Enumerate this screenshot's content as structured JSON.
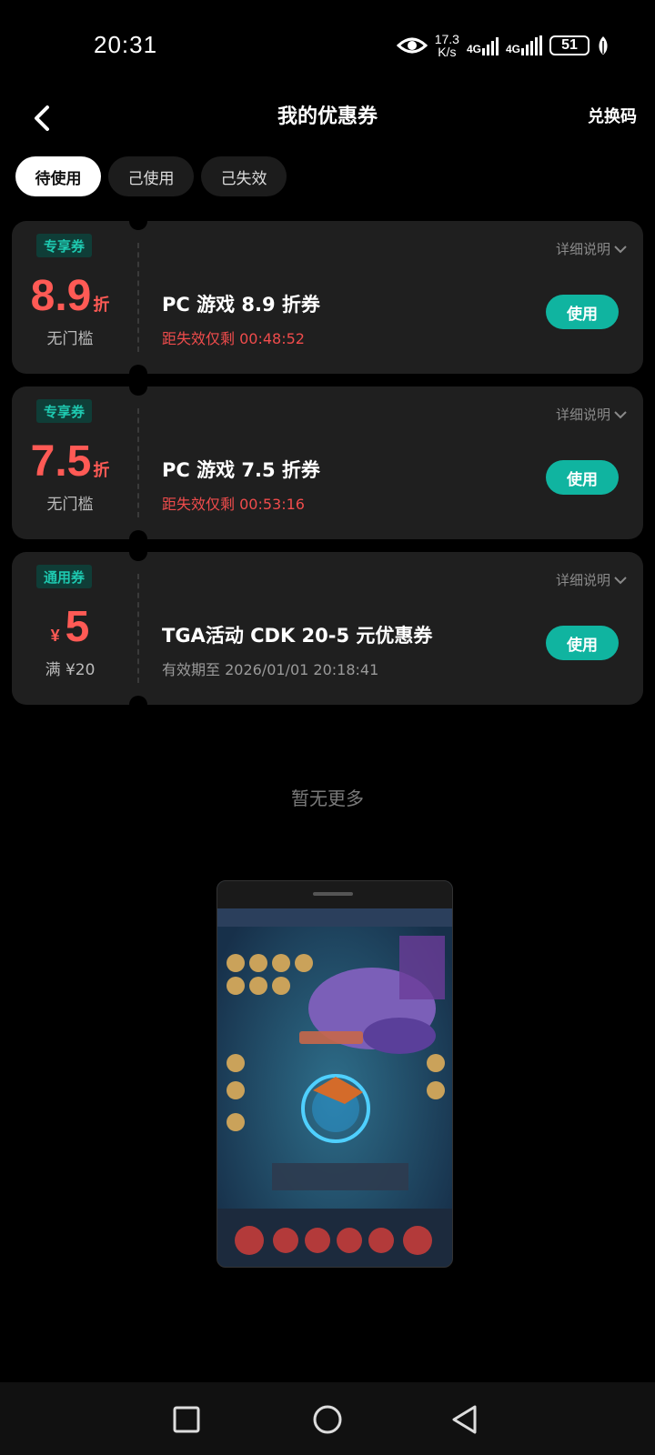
{
  "status": {
    "time": "20:31",
    "speed_value": "17.3",
    "speed_unit": "K/s",
    "net1": "4G",
    "net2": "4G",
    "battery": "51"
  },
  "header": {
    "title": "我的优惠券",
    "redeem": "兑换码"
  },
  "tabs": [
    "待使用",
    "己使用",
    "己失效"
  ],
  "coupons": [
    {
      "tag": "专享券",
      "value": "8.9",
      "unit": "折",
      "condition": "无门槛",
      "name": "PC 游戏 8.9 折券",
      "expire": "距失效仅剩 00:48:52",
      "detail": "详细说明",
      "button": "使用"
    },
    {
      "tag": "专享券",
      "value": "7.5",
      "unit": "折",
      "condition": "无门槛",
      "name": "PC 游戏 7.5 折券",
      "expire": "距失效仅剩 00:53:16",
      "detail": "详细说明",
      "button": "使用"
    },
    {
      "tag": "通用券",
      "currency": "¥",
      "value": "5",
      "condition": "满 ¥20",
      "name": "TGA活动 CDK 20-5 元优惠券",
      "expire": "有效期至 2026/01/01 20:18:41",
      "detail": "详细说明",
      "button": "使用"
    }
  ],
  "footer": {
    "no_more": "暂无更多"
  },
  "colors": {
    "accent": "#10b4a0",
    "value_red": "#ff5a55",
    "tag_text": "#1ec9b0"
  }
}
